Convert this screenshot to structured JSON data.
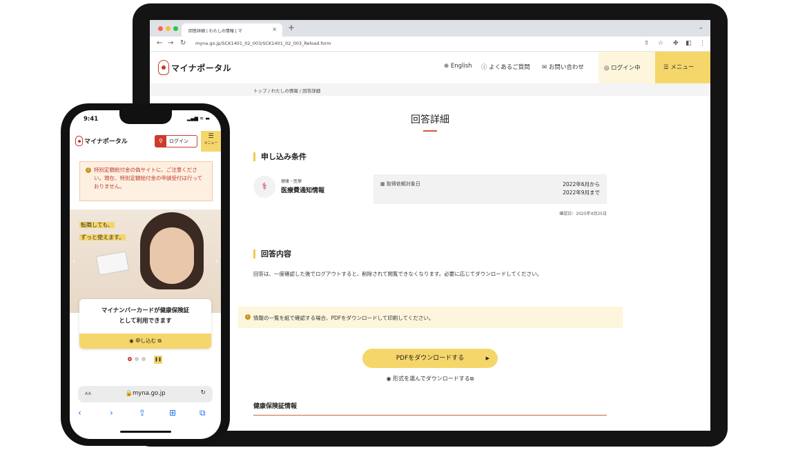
{
  "browser": {
    "tab_title": "回答詳細 | わたしの情報 | マ",
    "tab_close": "×",
    "new_tab": "+",
    "tab_caret": "⌄",
    "url": "myna.go.jp/SCK1401_02_003/SCK1401_02_003_Reload.form"
  },
  "site": {
    "logo_text": "マイナポータル",
    "nav": {
      "english": "English",
      "faq": "よくあるご質問",
      "contact": "お問い合わせ",
      "login": "ログイン中",
      "menu": "メニュー"
    },
    "breadcrumb": "トップ / わたしの情報 / 回答詳細"
  },
  "main": {
    "page_title": "回答詳細",
    "conditions": {
      "heading": "申し込み条件",
      "category": "健康・医療",
      "name": "医療費通知情報",
      "label": "取得依頼対象日",
      "value_line1": "2022年6月から",
      "value_line2": "2022年9月まで",
      "confirm_date": "確認日：2025年4月25日"
    },
    "answer": {
      "heading": "回答内容",
      "note": "回答は、一度確認した後でログアウトすると、削除されて閲覧できなくなります。必要に応じてダウンロードしてください。"
    },
    "info_banner": "情報の一覧を紙で確認する場合、PDFをダウンロードして印刷してください。",
    "pdf_button": "PDFをダウンロードする",
    "format_link": "形式を選んでダウンロードする",
    "insurance_heading": "健康保険証情報"
  },
  "phone": {
    "time": "9:41",
    "status": "▂▄▆ ≋ ▬",
    "logo_text": "マイナポータル",
    "login": "ログイン",
    "menu_label": "メニュー",
    "alert": "特別定額給付金の偽サイトに、ご注意ください。現在、特別定額給付金の申請受付は行っておりません。",
    "hero_line1": "転職しても、",
    "hero_line2": "ずっと使えます。",
    "card_title_line1": "マイナンバーカードが健康保険証",
    "card_title_line2": "として利用できます",
    "card_button": "◉ 申し込む ⧉",
    "url_aa": "AA",
    "url": "🔒myna.go.jp"
  },
  "colors": {
    "accent_yellow": "#f5d66a",
    "accent_red": "#cc3b2b",
    "light_yellow": "#fdf6dc"
  }
}
